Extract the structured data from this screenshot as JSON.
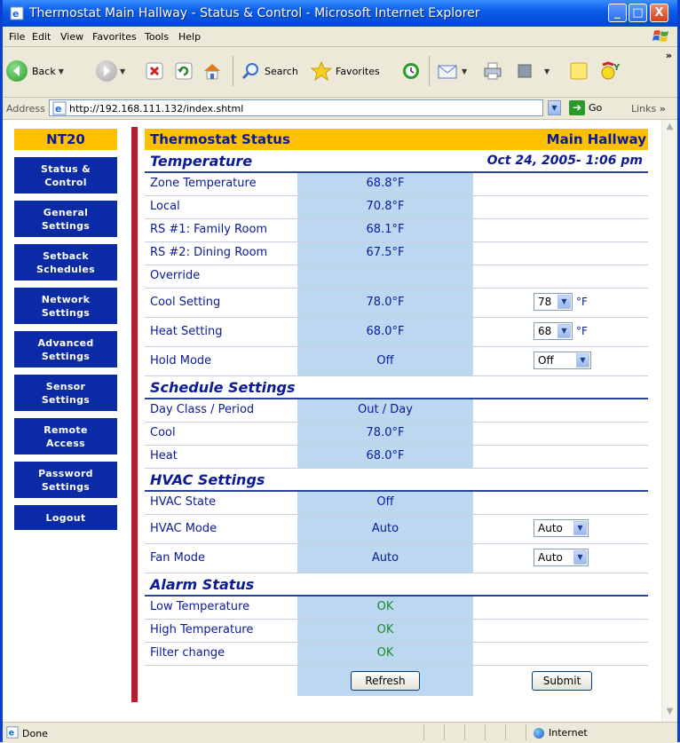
{
  "window": {
    "title": "Thermostat Main Hallway - Status & Control - Microsoft Internet Explorer",
    "min": "_",
    "max": "□",
    "close": "X"
  },
  "menu": [
    "File",
    "Edit",
    "View",
    "Favorites",
    "Tools",
    "Help"
  ],
  "toolbar": {
    "back": "Back",
    "search": "Search",
    "favorites": "Favorites"
  },
  "address": {
    "label": "Address",
    "url": "http://192.168.111.132/index.shtml",
    "go": "Go",
    "links": "Links"
  },
  "nav": {
    "brand": "NT20",
    "items": [
      {
        "l1": "Status &",
        "l2": "Control"
      },
      {
        "l1": "General",
        "l2": "Settings"
      },
      {
        "l1": "Setback",
        "l2": "Schedules"
      },
      {
        "l1": "Network",
        "l2": "Settings"
      },
      {
        "l1": "Advanced",
        "l2": "Settings"
      },
      {
        "l1": "Sensor",
        "l2": "Settings"
      },
      {
        "l1": "Remote",
        "l2": "Access"
      },
      {
        "l1": "Password",
        "l2": "Settings"
      },
      {
        "l1": "Logout"
      }
    ]
  },
  "header": {
    "title": "Thermostat Status",
    "location": "Main Hallway"
  },
  "temperature": {
    "heading": "Temperature",
    "datetime": "Oct 24, 2005- 1:06 pm",
    "zone": {
      "label": "Zone Temperature",
      "value": "68.8°F"
    },
    "local": {
      "label": "Local",
      "value": "70.8°F"
    },
    "rs1": {
      "label": "RS #1: Family Room",
      "value": "68.1°F"
    },
    "rs2": {
      "label": "RS #2: Dining Room",
      "value": "67.5°F"
    },
    "override": {
      "label": "Override",
      "value": ""
    },
    "cool": {
      "label": "Cool Setting",
      "value": "78.0°F",
      "select": "78",
      "unit": "°F"
    },
    "heat": {
      "label": "Heat Setting",
      "value": "68.0°F",
      "select": "68",
      "unit": "°F"
    },
    "hold": {
      "label": "Hold Mode",
      "value": "Off",
      "select": "Off"
    }
  },
  "schedule": {
    "heading": "Schedule Settings",
    "dayclass": {
      "label": "Day Class / Period",
      "value": "Out / Day"
    },
    "cool": {
      "label": "Cool",
      "value": "78.0°F"
    },
    "heat": {
      "label": "Heat",
      "value": "68.0°F"
    }
  },
  "hvac": {
    "heading": "HVAC Settings",
    "state": {
      "label": "HVAC State",
      "value": "Off"
    },
    "mode": {
      "label": "HVAC Mode",
      "value": "Auto",
      "select": "Auto"
    },
    "fan": {
      "label": "Fan Mode",
      "value": "Auto",
      "select": "Auto"
    }
  },
  "alarm": {
    "heading": "Alarm Status",
    "low": {
      "label": "Low Temperature",
      "value": "OK"
    },
    "high": {
      "label": "High Temperature",
      "value": "OK"
    },
    "filter": {
      "label": "Filter change",
      "value": "OK"
    }
  },
  "buttons": {
    "refresh": "Refresh",
    "submit": "Submit"
  },
  "status": {
    "text": "Done",
    "zone": "Internet"
  },
  "colors": {
    "nav": "#0b2aa6",
    "accent": "#ffc000",
    "valueCell": "#bcd8f0",
    "redBar": "#b51e2a",
    "ok": "#1a8a2a"
  }
}
